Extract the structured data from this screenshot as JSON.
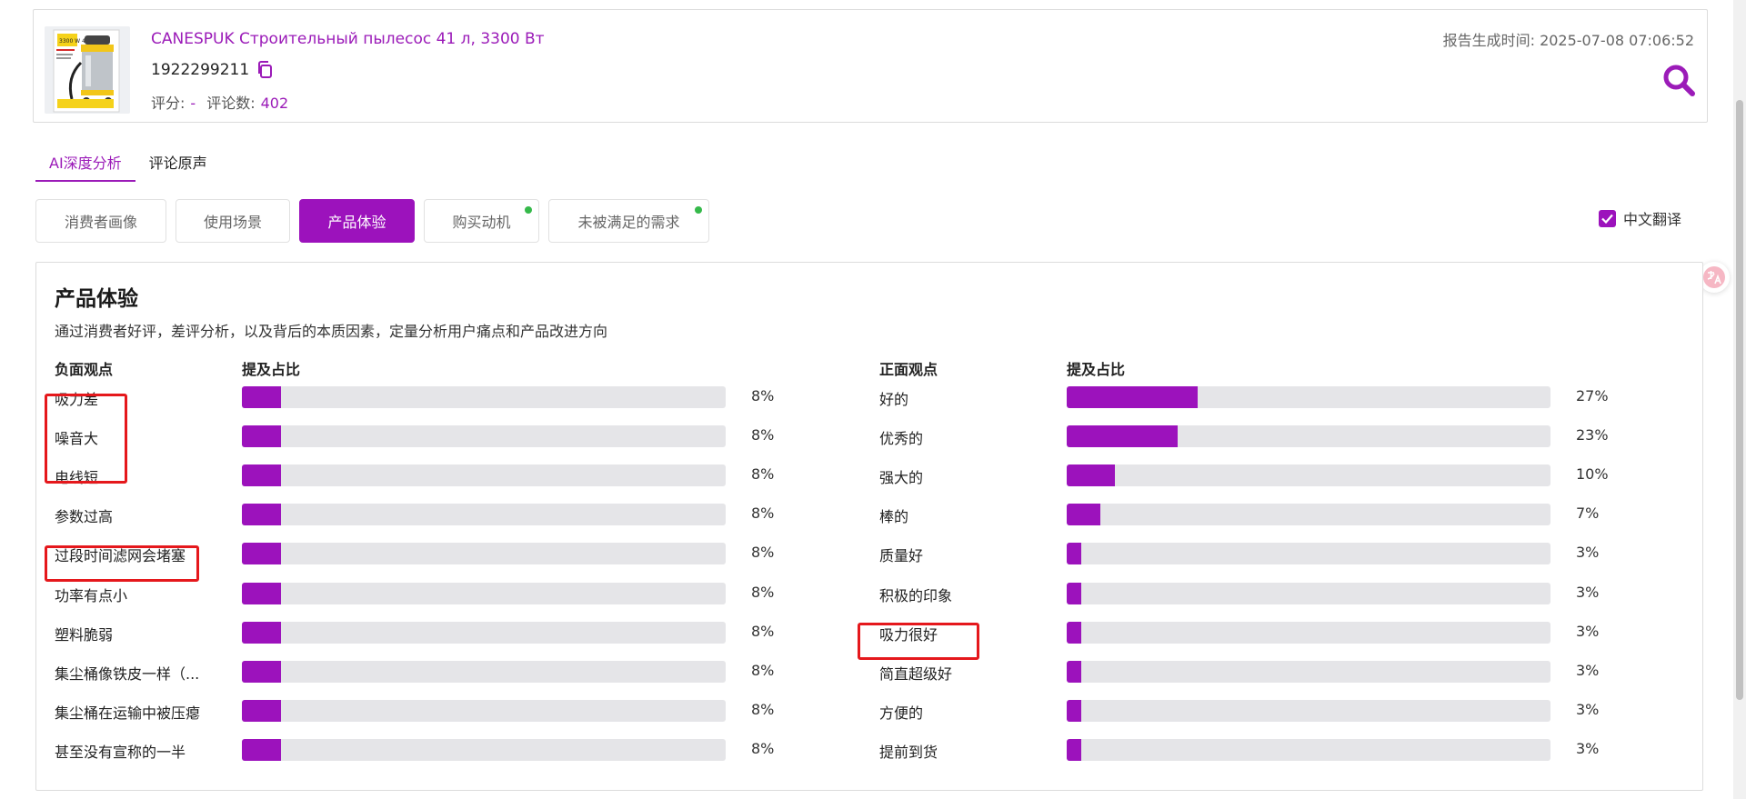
{
  "product": {
    "title": "CANESPUK Строительный пылесос 41 л, 3300 Вт",
    "asin": "1922299211",
    "rating_label": "评分:",
    "rating_value": "-",
    "reviews_label": "评论数:",
    "reviews_value": "402",
    "report_time_label": "报告生成时间:",
    "report_time_value": "2025-07-08 07:06:52",
    "thumb_text": "3300 W 41L"
  },
  "main_tabs": [
    {
      "label": "AI深度分析",
      "active": true
    },
    {
      "label": "评论原声",
      "active": false
    }
  ],
  "sub_tabs": [
    {
      "label": "消费者画像",
      "active": false,
      "dot": false
    },
    {
      "label": "使用场景",
      "active": false,
      "dot": false
    },
    {
      "label": "产品体验",
      "active": true,
      "dot": false
    },
    {
      "label": "购买动机",
      "active": false,
      "dot": true
    },
    {
      "label": "未被满足的需求",
      "active": false,
      "dot": true
    }
  ],
  "translate": {
    "label": "中文翻译",
    "checked": true
  },
  "panel": {
    "title": "产品体验",
    "description": "通过消费者好评，差评分析，以及背后的本质因素，定量分析用户痛点和产品改进方向"
  },
  "negative": {
    "header": "负面观点",
    "ratio_header": "提及占比",
    "items": [
      {
        "label": "吸力差",
        "percent": 8,
        "percent_text": "8%"
      },
      {
        "label": "噪音大",
        "percent": 8,
        "percent_text": "8%"
      },
      {
        "label": "电线短",
        "percent": 8,
        "percent_text": "8%"
      },
      {
        "label": "参数过高",
        "percent": 8,
        "percent_text": "8%"
      },
      {
        "label": "过段时间滤网会堵塞",
        "percent": 8,
        "percent_text": "8%"
      },
      {
        "label": "功率有点小",
        "percent": 8,
        "percent_text": "8%"
      },
      {
        "label": "塑料脆弱",
        "percent": 8,
        "percent_text": "8%"
      },
      {
        "label": "集尘桶像铁皮一样（...",
        "percent": 8,
        "percent_text": "8%"
      },
      {
        "label": "集尘桶在运输中被压瘪",
        "percent": 8,
        "percent_text": "8%"
      },
      {
        "label": "甚至没有宣称的一半",
        "percent": 8,
        "percent_text": "8%"
      }
    ]
  },
  "positive": {
    "header": "正面观点",
    "ratio_header": "提及占比",
    "items": [
      {
        "label": "好的",
        "percent": 27,
        "percent_text": "27%"
      },
      {
        "label": "优秀的",
        "percent": 23,
        "percent_text": "23%"
      },
      {
        "label": "强大的",
        "percent": 10,
        "percent_text": "10%"
      },
      {
        "label": "棒的",
        "percent": 7,
        "percent_text": "7%"
      },
      {
        "label": "质量好",
        "percent": 3,
        "percent_text": "3%"
      },
      {
        "label": "积极的印象",
        "percent": 3,
        "percent_text": "3%"
      },
      {
        "label": "吸力很好",
        "percent": 3,
        "percent_text": "3%"
      },
      {
        "label": "简直超级好",
        "percent": 3,
        "percent_text": "3%"
      },
      {
        "label": "方便的",
        "percent": 3,
        "percent_text": "3%"
      },
      {
        "label": "提前到货",
        "percent": 3,
        "percent_text": "3%"
      }
    ]
  },
  "colors": {
    "accent": "#9c12bc",
    "link": "#9b1bb8",
    "track": "#e5e5e8",
    "highlight": "#e5181c",
    "status_dot": "#35b94a"
  }
}
